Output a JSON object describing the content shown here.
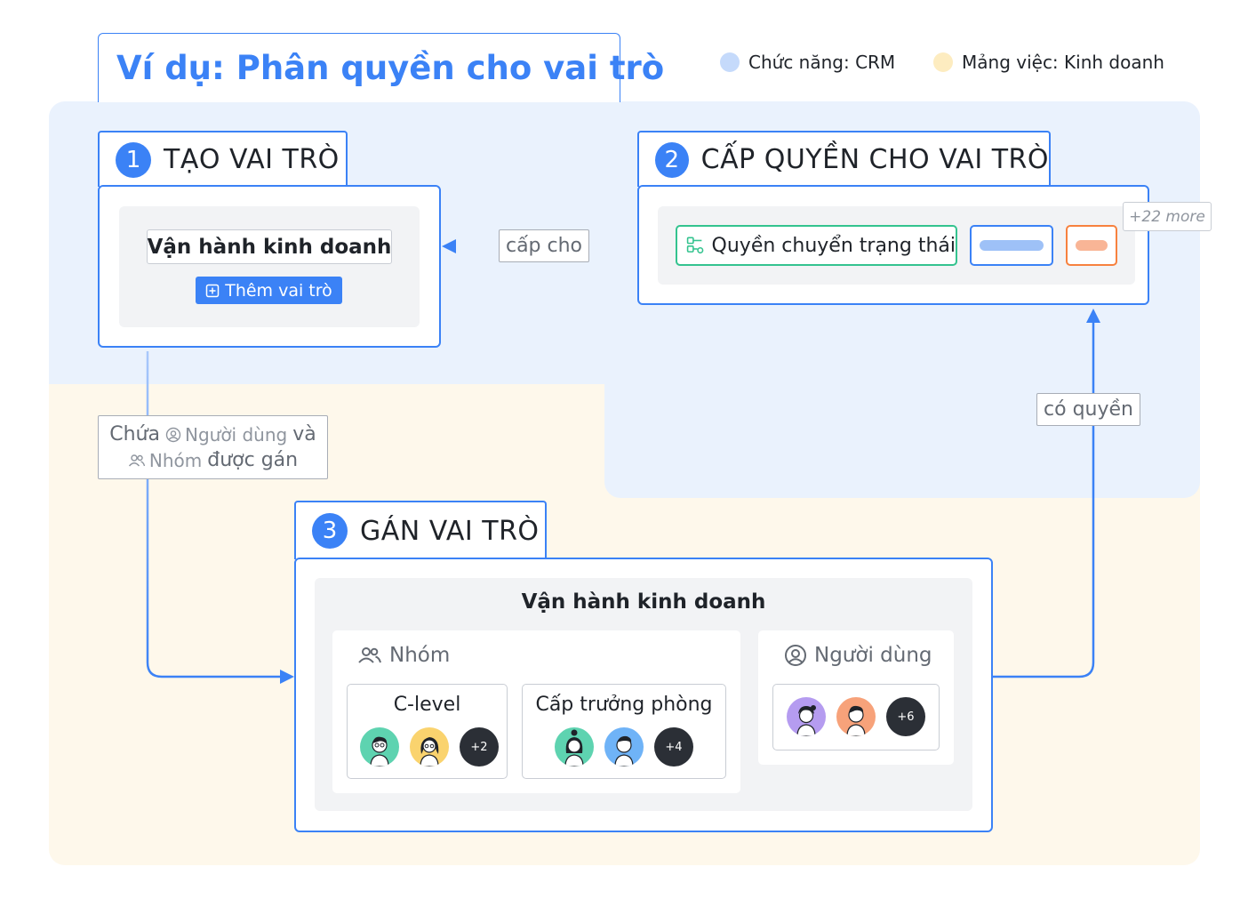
{
  "title": "Ví dụ: Phân quyền cho vai trò",
  "legend": [
    {
      "label": "Chức năng: CRM",
      "color": "#c5dafb"
    },
    {
      "label": "Mảng việc: Kinh doanh",
      "color": "#fdecc0"
    }
  ],
  "steps": [
    {
      "number": "1",
      "title": "TẠO VAI TRÒ"
    },
    {
      "number": "2",
      "title": "CẤP QUYỀN CHO VAI TRÒ"
    },
    {
      "number": "3",
      "title": "GÁN VAI TRÒ"
    }
  ],
  "create_role": {
    "role_name": "Vận hành kinh doanh",
    "add_button": "Thêm vai trò"
  },
  "permissions": {
    "primary": "Quyền chuyển trạng thái",
    "more": "+22 more"
  },
  "connectors": {
    "grant_to": "cấp cho",
    "has_permission": "có quyền",
    "contains_prefix": "Chứa",
    "contains_users": "Người dùng",
    "contains_and": "và",
    "contains_groups": "Nhóm",
    "contains_suffix": "được gán"
  },
  "assign": {
    "role_name": "Vận hành kinh doanh",
    "groups_label": "Nhóm",
    "users_label": "Người dùng",
    "groups": [
      {
        "name": "C-level",
        "more": "+2"
      },
      {
        "name": "Cấp trưởng phòng",
        "more": "+4"
      }
    ],
    "users_more": "+6"
  },
  "colors": {
    "accent": "#3b82f6",
    "crm_zone": "#eaf2fd",
    "business_zone": "#fef8eb",
    "permission_green": "#34c38f",
    "permission_orange": "#f7813e"
  }
}
